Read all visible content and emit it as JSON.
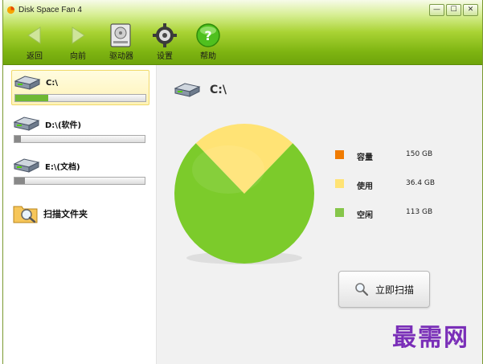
{
  "window": {
    "title": "Disk Space Fan 4",
    "controls": {
      "minimize": "—",
      "maximize": "☐",
      "close": "✕"
    }
  },
  "toolbar": [
    {
      "label": "返回",
      "icon": "back-arrow-icon"
    },
    {
      "label": "向前",
      "icon": "forward-arrow-icon"
    },
    {
      "label": "驱动器",
      "icon": "drive-icon"
    },
    {
      "label": "设置",
      "icon": "gear-icon"
    },
    {
      "label": "帮助",
      "icon": "help-icon"
    }
  ],
  "drives": [
    {
      "label": "C:\\",
      "used_fraction": 0.25,
      "selected": true,
      "bar_color": "#6fb833"
    },
    {
      "label": "D:\\(软件)",
      "used_fraction": 0.05,
      "selected": false,
      "bar_color": "#888888"
    },
    {
      "label": "E:\\(文档)",
      "used_fraction": 0.08,
      "selected": false,
      "bar_color": "#888888"
    }
  ],
  "scan_folder_label": "扫描文件夹",
  "main": {
    "drive_label": "C:\\",
    "legend": [
      {
        "name": "容量",
        "value": "150 GB",
        "color": "#f07b00"
      },
      {
        "name": "使用",
        "value": "36.4 GB",
        "color": "#ffe375"
      },
      {
        "name": "空闲",
        "value": "113 GB",
        "color": "#86c64a"
      }
    ],
    "scan_button": "立即扫描"
  },
  "chart_data": {
    "type": "pie",
    "categories": [
      "使用",
      "空闲"
    ],
    "values": [
      36.4,
      113
    ],
    "colors": [
      "#ffe375",
      "#7ccb2b"
    ]
  },
  "watermark": "最需网"
}
